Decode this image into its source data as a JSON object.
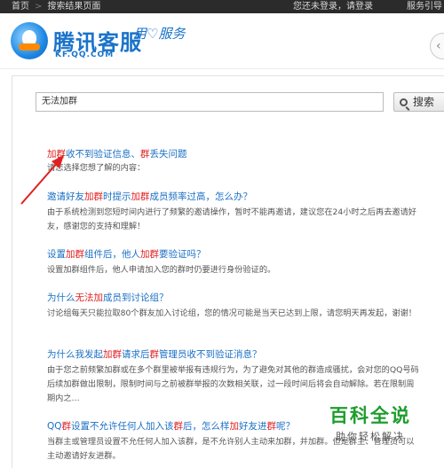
{
  "topbar": {
    "home": "首页",
    "separator": ">",
    "current": "搜索结果页面",
    "login_text": "您还未登录，请登录",
    "help_text": "服务引导"
  },
  "header": {
    "logo_text": "腾讯客服",
    "logo_url": "KF.QQ.COM",
    "slogan_left": "用",
    "slogan_heart": "♡",
    "slogan_right": "服务",
    "side_button_glyph": "‹"
  },
  "search": {
    "value": "无法加群",
    "button_label": "搜索"
  },
  "results": [
    {
      "title_parts": [
        {
          "text": "加群",
          "hl": true
        },
        {
          "text": "收不到验证信息、",
          "hl": false
        },
        {
          "text": "群",
          "hl": true
        },
        {
          "text": "丢失问题",
          "hl": false
        }
      ],
      "desc": "请您选择您想了解的内容："
    },
    {
      "title_parts": [
        {
          "text": "邀请好友",
          "hl": false
        },
        {
          "text": "加群",
          "hl": true
        },
        {
          "text": "时提示",
          "hl": false
        },
        {
          "text": "加群",
          "hl": true
        },
        {
          "text": "成员频率过高，怎么办？",
          "hl": false
        }
      ],
      "desc": "由于系统检测到您短时间内进行了频繁的邀请操作，暂时不能再邀请，建议您在24小时之后再去邀请好友，感谢您的支持和理解！"
    },
    {
      "title_parts": [
        {
          "text": "设置",
          "hl": false
        },
        {
          "text": "加群",
          "hl": true
        },
        {
          "text": "组件后，他人",
          "hl": false
        },
        {
          "text": "加群",
          "hl": true
        },
        {
          "text": "要验证吗？",
          "hl": false
        }
      ],
      "desc": "设置加群组件后，他人申请加入您的群时仍要进行身份验证的。"
    },
    {
      "title_parts": [
        {
          "text": "为什么",
          "hl": false
        },
        {
          "text": "无法加",
          "hl": true
        },
        {
          "text": "成员到讨论组？",
          "hl": false
        }
      ],
      "desc": "讨论组每天只能拉取80个群友加入讨论组，您的情况可能是当天已达到上限，请您明天再发起，谢谢！"
    },
    {
      "title_parts": [
        {
          "text": "为什么我发起",
          "hl": false
        },
        {
          "text": "加群",
          "hl": true
        },
        {
          "text": "请求后",
          "hl": false
        },
        {
          "text": "群",
          "hl": true
        },
        {
          "text": "管理员收不到验证消息？",
          "hl": false
        }
      ],
      "desc": "由于您之前频繁加群或在多个群里被举报有违规行为，为了避免对其他的群造成骚扰，会对您的QQ号码后续加群做出限制，限制时间与之前被群举报的次数相关联，过一段时间后将会自动解除。若在限制周期内之…"
    },
    {
      "title_parts": [
        {
          "text": "QQ",
          "hl": false
        },
        {
          "text": "群",
          "hl": true
        },
        {
          "text": "设置不允许任何人加入该",
          "hl": false
        },
        {
          "text": "群",
          "hl": true
        },
        {
          "text": "后，怎么样",
          "hl": false
        },
        {
          "text": "加",
          "hl": true
        },
        {
          "text": "好友进",
          "hl": false
        },
        {
          "text": "群",
          "hl": true
        },
        {
          "text": "呢？",
          "hl": false
        }
      ],
      "desc": "当群主或管理员设置不允任何人加入该群，是不允许别人主动来加群，并加群。但是群主、管理员可以主动邀请好友进群。"
    }
  ],
  "watermark": {
    "title": "百科全说",
    "subtitle": "助你轻松解决"
  },
  "colors": {
    "link": "#1a6fc4",
    "highlight": "#e02020",
    "brand": "#1a73c9",
    "topbar": "#2b2b2b",
    "arrow": "#e02020",
    "watermark": "#1e9d2e"
  }
}
